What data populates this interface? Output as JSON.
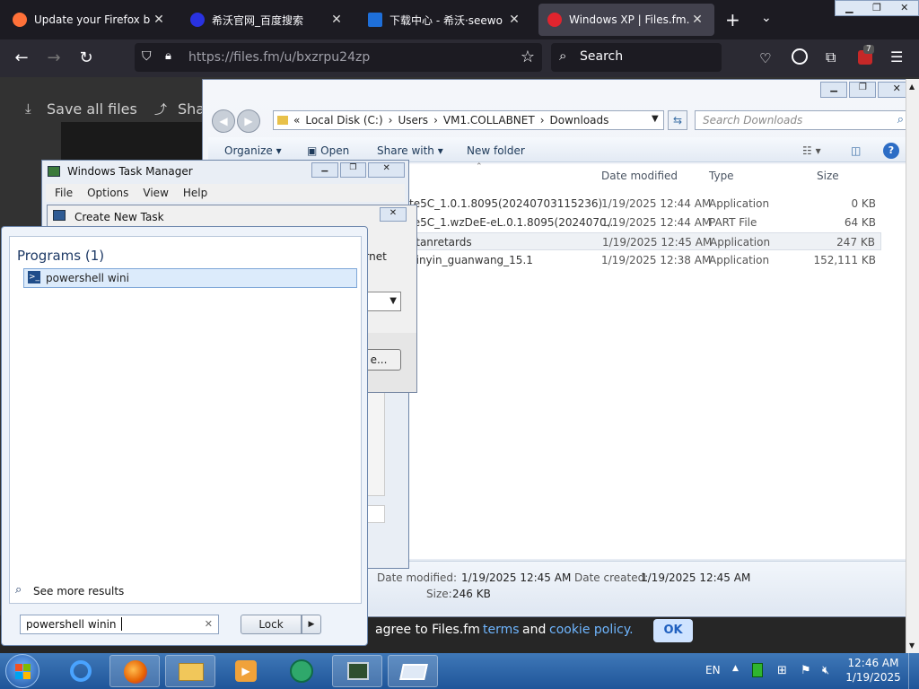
{
  "browser": {
    "tabs": [
      {
        "title": "Update your Firefox browse",
        "active": false,
        "favicon_color": "#ff7139"
      },
      {
        "title": "希沃官网_百度搜索",
        "active": false,
        "favicon_color": "#2932e1"
      },
      {
        "title": "下载中心 - 希沃·seewo",
        "active": false,
        "favicon_color": "#1e6fd9"
      },
      {
        "title": "Windows XP | Files.fm.",
        "active": true,
        "favicon_color": "#e0242e"
      }
    ],
    "url": "https://files.fm/u/bxzrpu24zp",
    "search_placeholder": "Search",
    "ext_badge": "7"
  },
  "page": {
    "save_all_label": "Save all files",
    "share_label": "Sha",
    "cookie_text_pre": "agree to Files.fm",
    "cookie_terms": "terms",
    "cookie_and": "and",
    "cookie_policy": "cookie policy.",
    "ok_label": "OK"
  },
  "explorer": {
    "breadcrumb": [
      "Local Disk (C:)",
      "Users",
      "VM1.COLLABNET",
      "Downloads"
    ],
    "search_placeholder": "Search Downloads",
    "toolbar": {
      "organize": "Organize",
      "open": "Open",
      "share_with": "Share with",
      "new_folder": "New folder"
    },
    "columns": {
      "date": "Date modified",
      "type": "Type",
      "size": "Size"
    },
    "files": [
      {
        "name": "te5C_1.0.1.8095(20240703115236)",
        "date": "1/19/2025 12:44 AM",
        "type": "Application",
        "size": "0 KB"
      },
      {
        "name": "te5C_1.wzDeE-eL.0.1.8095(2024070...",
        "date": "1/19/2025 12:44 AM",
        "type": "PART File",
        "size": "64 KB"
      },
      {
        "name": "stanretards",
        "date": "1/19/2025 12:45 AM",
        "type": "Application",
        "size": "247 KB"
      },
      {
        "name": "pinyin_guanwang_15.1",
        "date": "1/19/2025 12:38 AM",
        "type": "Application",
        "size": "152,111 KB"
      }
    ],
    "details": {
      "modified_label": "Date modified:",
      "modified_value": "1/19/2025 12:45 AM",
      "created_label": "Date created:",
      "created_value": "1/19/2025 12:45 AM",
      "size_label": "Size:",
      "size_value": "246 KB"
    }
  },
  "taskmgr": {
    "title": "Windows Task Manager",
    "menu": [
      "File",
      "Options",
      "View",
      "Help"
    ]
  },
  "newtask": {
    "title": "Create New Task",
    "fragment": "ernet",
    "browse_fragment": "e..."
  },
  "startmenu": {
    "section": "Programs (1)",
    "result": "powershell wini",
    "see_more": "See more results",
    "search_value": "powershell winin",
    "lock_label": "Lock"
  },
  "taskbar": {
    "lang": "EN",
    "time": "12:46 AM",
    "date": "1/19/2025"
  }
}
